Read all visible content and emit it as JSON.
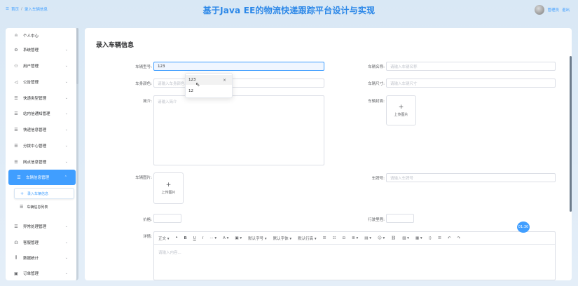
{
  "header": {
    "home_icon": "menu-icon",
    "breadcrumb_home": "首页",
    "breadcrumb_sep": "/",
    "breadcrumb_current": "录入车辆信息",
    "title": "基于Java EE的物流快递跟踪平台设计与实现",
    "user_label": "管理员",
    "logout_label": "退出"
  },
  "sidebar": {
    "items": [
      {
        "label": "个人中心",
        "icon": "user-icon",
        "chev": ""
      },
      {
        "label": "系统管理",
        "icon": "gear-icon",
        "chev": "⌄"
      },
      {
        "label": "用户管理",
        "icon": "users-icon",
        "chev": "⌄"
      },
      {
        "label": "公告管理",
        "icon": "speaker-icon",
        "chev": "⌄"
      },
      {
        "label": "快递类型管理",
        "icon": "list-icon",
        "chev": "⌄"
      },
      {
        "label": "站内信通知管理",
        "icon": "list-icon",
        "chev": "⌄"
      },
      {
        "label": "快递信息管理",
        "icon": "list-icon",
        "chev": "⌄"
      },
      {
        "label": "分拨中心管理",
        "icon": "list-icon",
        "chev": "⌄"
      },
      {
        "label": "网点信息管理",
        "icon": "list-icon",
        "chev": "⌄"
      },
      {
        "label": "车辆信息管理",
        "icon": "list-icon",
        "chev": "⌃"
      },
      {
        "label": "异常处理管理",
        "icon": "list-icon",
        "chev": "⌄"
      },
      {
        "label": "客服管理",
        "icon": "headset-icon",
        "chev": "⌄"
      },
      {
        "label": "数据统计",
        "icon": "chart-icon",
        "chev": "⌄"
      },
      {
        "label": "订单管理",
        "icon": "order-icon",
        "chev": "⌄"
      }
    ],
    "subitems": [
      {
        "label": "录入车辆信息",
        "icon": "plus-icon"
      },
      {
        "label": "车辆信息列表",
        "icon": "list-icon"
      }
    ]
  },
  "form": {
    "page_title": "录入车辆信息",
    "model_label": "车辆型号:",
    "model_value": "123",
    "name_label": "车辆名称:",
    "name_placeholder": "请输入车辆名称",
    "color_label": "车身颜色:",
    "color_placeholder": "请输入车身颜色",
    "size_label": "车辆尺寸:",
    "size_placeholder": "请输入车辆尺寸",
    "intro_label": "简介:",
    "intro_placeholder": "请输入简介",
    "cover_label": "车辆封面:",
    "upload_label": "上传图片",
    "photo_label": "车辆图片:",
    "plate_label": "车牌号:",
    "plate_placeholder": "请输入车牌号",
    "price_label": "价格:",
    "mileage_label": "行驶里程:",
    "detail_label": "详情:",
    "editor_placeholder": "请输入内容...",
    "dropdown": [
      "123",
      "12"
    ],
    "dropdown_close": "×"
  },
  "toolbar": {
    "items": [
      "正文 ▾",
      "❝",
      "B",
      "U",
      "I",
      "··· ▾",
      "A ▾",
      "▣ ▾",
      "默认字号 ▾",
      "默认字体 ▾",
      "默认行高 ▾",
      "☰",
      "☷",
      "⊟",
      "≣ ▾",
      "▤ ▾",
      "☺ ▾",
      "⛓",
      "▨ ▾",
      "▦ ▾",
      "⟨⟩",
      "☰",
      "↶",
      "↷"
    ]
  },
  "timer": "01:30"
}
